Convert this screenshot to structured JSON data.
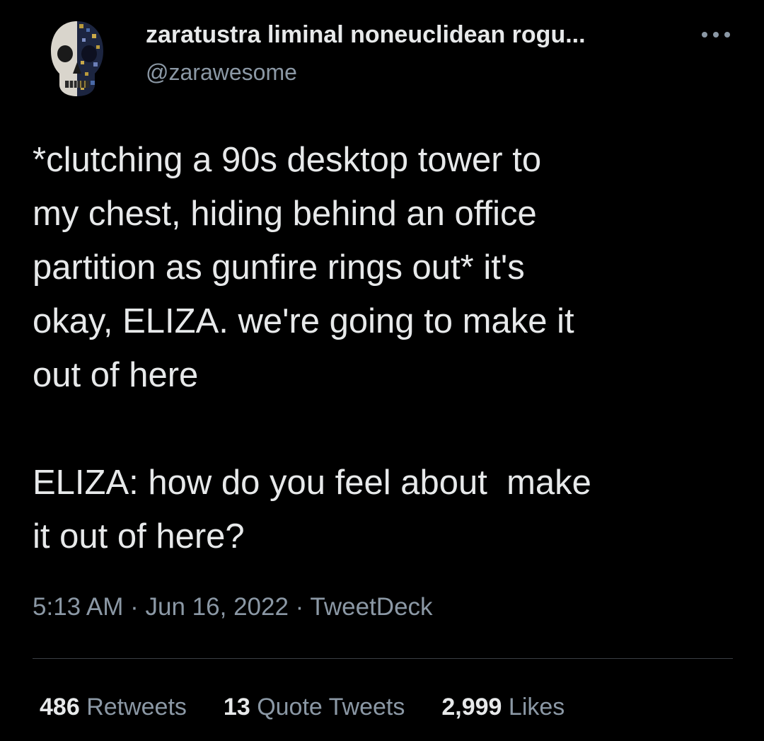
{
  "author": {
    "display_name": "zaratustra liminal noneuclidean rogu...",
    "handle": "@zarawesome",
    "avatar_icon": "skull-avatar-icon"
  },
  "more_icon": "more-horizontal-icon",
  "tweet": {
    "text_paragraph_1": "*clutching a 90s desktop tower to\nmy chest, hiding behind an office\npartition as gunfire rings out* it's\nokay, ELIZA. we're going to make it\nout of here",
    "text_paragraph_2": "ELIZA: how do you feel about  make\nit out of here?",
    "time": "5:13 AM",
    "date": "Jun 16, 2022",
    "separator": " · ",
    "source": "TweetDeck"
  },
  "stats": {
    "retweets": {
      "count": "486",
      "label": "Retweets"
    },
    "quote_tweets": {
      "count": "13",
      "label": "Quote Tweets"
    },
    "likes": {
      "count": "2,999",
      "label": "Likes"
    }
  },
  "colors": {
    "background": "#000000",
    "primary_text": "#e7e9ea",
    "secondary_text": "#8b98a5",
    "divider": "#3a3f44"
  }
}
